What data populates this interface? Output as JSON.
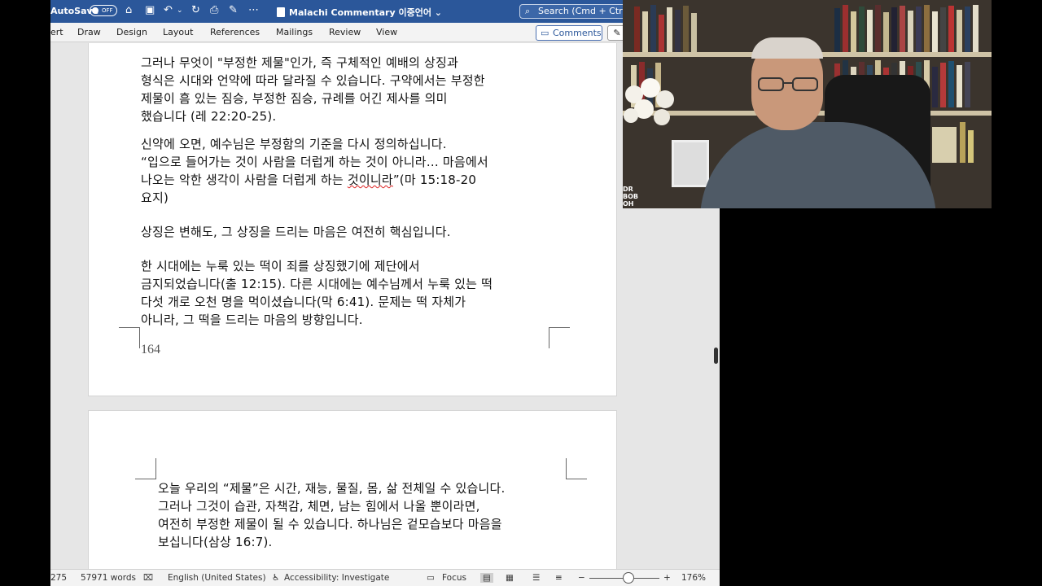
{
  "titlebar": {
    "autosave_label": "AutoSave",
    "autosave_state": "OFF",
    "document_title": "Malachi Commentary 이중언어",
    "search_placeholder": "Search (Cmd + Ctrl +"
  },
  "ribbon": {
    "tabs": [
      "ert",
      "Draw",
      "Design",
      "Layout",
      "References",
      "Mailings",
      "Review",
      "View"
    ],
    "comments_label": "Comments"
  },
  "page1": {
    "lines_top": [
      "그러나 무엇이 \"부정한 제물\"인가, 즉 구체적인 예배의 상징과",
      "형식은 시대와 언약에 따라 달라질 수 있습니다. 구약에서는 부정한",
      "제물이 흠 있는 짐승, 부정한 짐승, 규례를 어긴 제사를 의미",
      "했습니다 (레 22:20-25)."
    ],
    "para2_line1": "신약에 오면, 예수님은 부정함의 기준을 다시 정의하십니다.",
    "para2_line2": "“입으로 들어가는 것이 사람을 더럽게 하는 것이 아니라… 마음에서",
    "para2_line3_a": "나오는 악한 생각이 사람을 더럽게 하는 ",
    "para2_line3_b": "것이니라",
    "para2_line3_c": "”(마 15:18-20",
    "para2_line4": "요지)",
    "para3": "상징은 변해도, 그 상징을 드리는 마음은 여전히 핵심입니다.",
    "para4": [
      "한 시대에는 누룩 있는 떡이 죄를 상징했기에 제단에서",
      "금지되었습니다(출 12:15). 다른 시대에는 예수님께서 누룩 있는 떡",
      "다섯 개로 오천 명을 먹이셨습니다(막 6:41). 문제는 떡 자체가",
      "아니라, 그 떡을 드리는 마음의 방향입니다."
    ],
    "page_number": "164"
  },
  "page2": {
    "lines": [
      "오늘 우리의 “제물”은 시간, 재능, 물질, 몸, 삶 전체일 수 있습니다.",
      "그러나 그것이 습관, 자책감, 체면, 남는 힘에서 나올 뿐이라면,",
      "여전히 부정한 제물이 될 수 있습니다. 하나님은 겉모습보다 마음을",
      "보십니다(삼상 16:7)."
    ]
  },
  "status": {
    "page_info": "275",
    "word_count": "57971 words",
    "language": "English (United States)",
    "accessibility": "Accessibility: Investigate",
    "focus": "Focus",
    "zoom": "176%"
  },
  "webcam": {
    "overlay_text": "DR BOB OH TV"
  }
}
